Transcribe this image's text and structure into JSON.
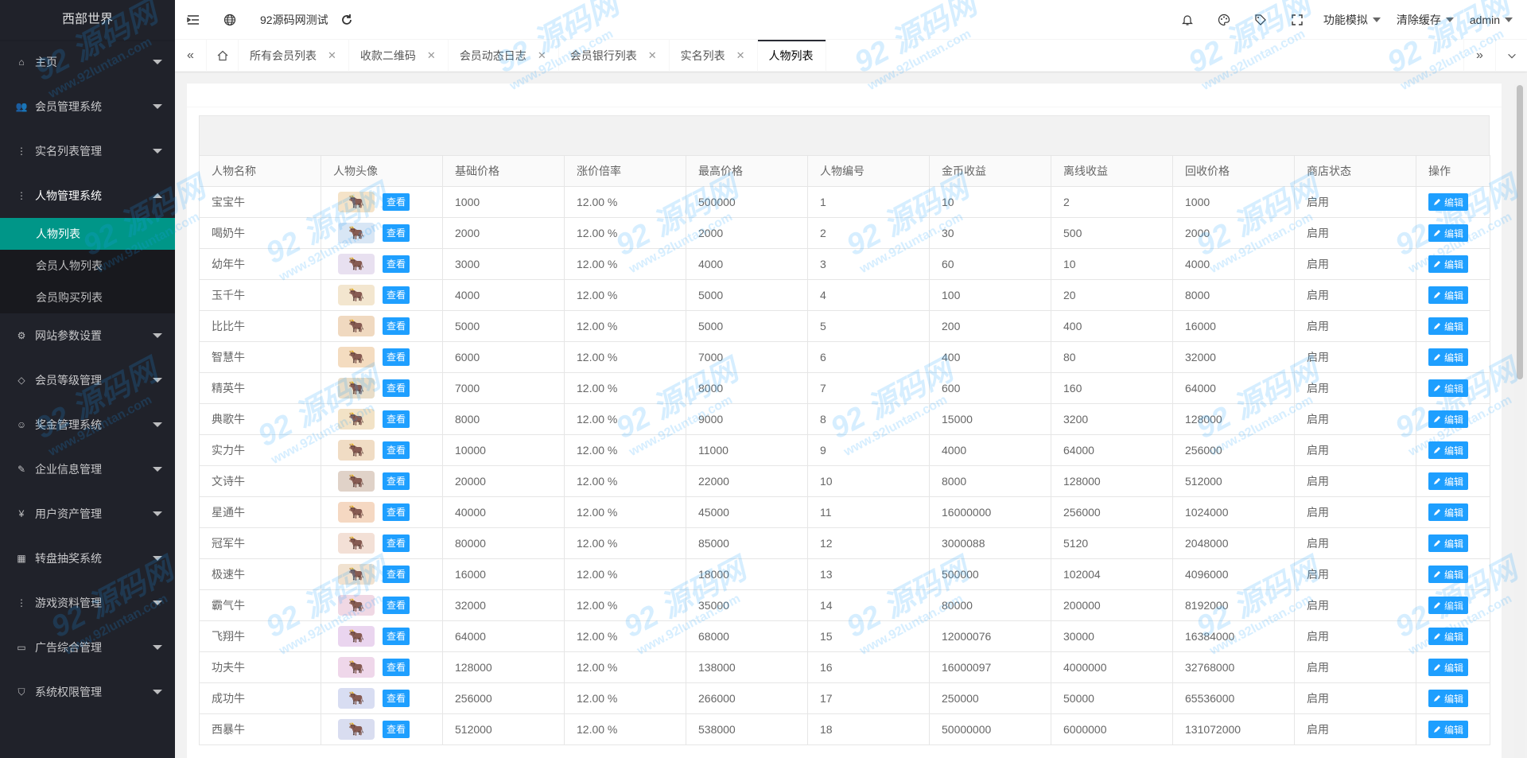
{
  "sidebar": {
    "logo": "西部世界",
    "items": [
      {
        "label": "主页",
        "icon": "home-icon",
        "glyph": "⌂"
      },
      {
        "label": "会员管理系统",
        "icon": "users-icon",
        "glyph": "👥"
      },
      {
        "label": "实名列表管理",
        "icon": "more-icon",
        "glyph": "⋮"
      },
      {
        "label": "人物管理系统",
        "icon": "more-icon",
        "glyph": "⋮",
        "open": true
      },
      {
        "label": "网站参数设置",
        "icon": "gear-icon",
        "glyph": "⚙"
      },
      {
        "label": "会员等级管理",
        "icon": "diamond-icon",
        "glyph": "◇"
      },
      {
        "label": "奖金管理系统",
        "icon": "smile-icon",
        "glyph": "☺"
      },
      {
        "label": "企业信息管理",
        "icon": "edit-icon",
        "glyph": "✎"
      },
      {
        "label": "用户资产管理",
        "icon": "yen-icon",
        "glyph": "¥"
      },
      {
        "label": "转盘抽奖系统",
        "icon": "app-icon",
        "glyph": "▦"
      },
      {
        "label": "游戏资料管理",
        "icon": "more-icon",
        "glyph": "⋮"
      },
      {
        "label": "广告综合管理",
        "icon": "monitor-icon",
        "glyph": "▭"
      },
      {
        "label": "系统权限管理",
        "icon": "shield-icon",
        "glyph": "⛉"
      }
    ],
    "submenu": [
      "人物列表",
      "会员人物列表",
      "会员购买列表"
    ]
  },
  "header": {
    "site_name": "92源码网测试",
    "function_menu": "功能模拟",
    "clear_cache": "清除缓存",
    "user": "admin"
  },
  "tabs": [
    {
      "label": "所有会员列表",
      "active": false
    },
    {
      "label": "收款二维码",
      "active": false
    },
    {
      "label": "会员动态日志",
      "active": false
    },
    {
      "label": "会员银行列表",
      "active": false
    },
    {
      "label": "实名列表",
      "active": false
    },
    {
      "label": "人物列表",
      "active": true
    }
  ],
  "table": {
    "headers": [
      "人物名称",
      "人物头像",
      "基础价格",
      "涨价倍率",
      "最高价格",
      "人物编号",
      "金币收益",
      "离线收益",
      "回收价格",
      "商店状态",
      "操作"
    ],
    "view_label": "查看",
    "edit_label": "编辑",
    "rows": [
      {
        "name": "宝宝牛",
        "base": "1000",
        "rate": "12.00 %",
        "max": "500000",
        "id": "1",
        "gold": "10",
        "offline": "2",
        "recycle": "1000",
        "status": "启用"
      },
      {
        "name": "喝奶牛",
        "base": "2000",
        "rate": "12.00 %",
        "max": "2000",
        "id": "2",
        "gold": "30",
        "offline": "500",
        "recycle": "2000",
        "status": "启用"
      },
      {
        "name": "幼年牛",
        "base": "3000",
        "rate": "12.00 %",
        "max": "4000",
        "id": "3",
        "gold": "60",
        "offline": "10",
        "recycle": "4000",
        "status": "启用"
      },
      {
        "name": "玉千牛",
        "base": "4000",
        "rate": "12.00 %",
        "max": "5000",
        "id": "4",
        "gold": "100",
        "offline": "20",
        "recycle": "8000",
        "status": "启用"
      },
      {
        "name": "比比牛",
        "base": "5000",
        "rate": "12.00 %",
        "max": "5000",
        "id": "5",
        "gold": "200",
        "offline": "400",
        "recycle": "16000",
        "status": "启用"
      },
      {
        "name": "智慧牛",
        "base": "6000",
        "rate": "12.00 %",
        "max": "7000",
        "id": "6",
        "gold": "400",
        "offline": "80",
        "recycle": "32000",
        "status": "启用"
      },
      {
        "name": "精英牛",
        "base": "7000",
        "rate": "12.00 %",
        "max": "8000",
        "id": "7",
        "gold": "600",
        "offline": "160",
        "recycle": "64000",
        "status": "启用"
      },
      {
        "name": "典歌牛",
        "base": "8000",
        "rate": "12.00 %",
        "max": "9000",
        "id": "8",
        "gold": "15000",
        "offline": "3200",
        "recycle": "128000",
        "status": "启用"
      },
      {
        "name": "实力牛",
        "base": "10000",
        "rate": "12.00 %",
        "max": "11000",
        "id": "9",
        "gold": "4000",
        "offline": "64000",
        "recycle": "256000",
        "status": "启用"
      },
      {
        "name": "文诗牛",
        "base": "20000",
        "rate": "12.00 %",
        "max": "22000",
        "id": "10",
        "gold": "8000",
        "offline": "128000",
        "recycle": "512000",
        "status": "启用"
      },
      {
        "name": "星通牛",
        "base": "40000",
        "rate": "12.00 %",
        "max": "45000",
        "id": "11",
        "gold": "16000000",
        "offline": "256000",
        "recycle": "1024000",
        "status": "启用"
      },
      {
        "name": "冠军牛",
        "base": "80000",
        "rate": "12.00 %",
        "max": "85000",
        "id": "12",
        "gold": "3000088",
        "offline": "5120",
        "recycle": "2048000",
        "status": "启用"
      },
      {
        "name": "极速牛",
        "base": "16000",
        "rate": "12.00 %",
        "max": "18000",
        "id": "13",
        "gold": "500000",
        "offline": "102004",
        "recycle": "4096000",
        "status": "启用"
      },
      {
        "name": "霸气牛",
        "base": "32000",
        "rate": "12.00 %",
        "max": "35000",
        "id": "14",
        "gold": "80000",
        "offline": "200000",
        "recycle": "8192000",
        "status": "启用"
      },
      {
        "name": "飞翔牛",
        "base": "64000",
        "rate": "12.00 %",
        "max": "68000",
        "id": "15",
        "gold": "12000076",
        "offline": "30000",
        "recycle": "16384000",
        "status": "启用"
      },
      {
        "name": "功夫牛",
        "base": "128000",
        "rate": "12.00 %",
        "max": "138000",
        "id": "16",
        "gold": "16000097",
        "offline": "4000000",
        "recycle": "32768000",
        "status": "启用"
      },
      {
        "name": "成功牛",
        "base": "256000",
        "rate": "12.00 %",
        "max": "266000",
        "id": "17",
        "gold": "250000",
        "offline": "50000",
        "recycle": "65536000",
        "status": "启用"
      },
      {
        "name": "西暴牛",
        "base": "512000",
        "rate": "12.00 %",
        "max": "538000",
        "id": "18",
        "gold": "50000000",
        "offline": "6000000",
        "recycle": "131072000",
        "status": "启用"
      }
    ]
  },
  "colors": {
    "sidebar_bg": "#20222a",
    "active_menu": "#009688",
    "button_blue": "#1e9fff"
  }
}
